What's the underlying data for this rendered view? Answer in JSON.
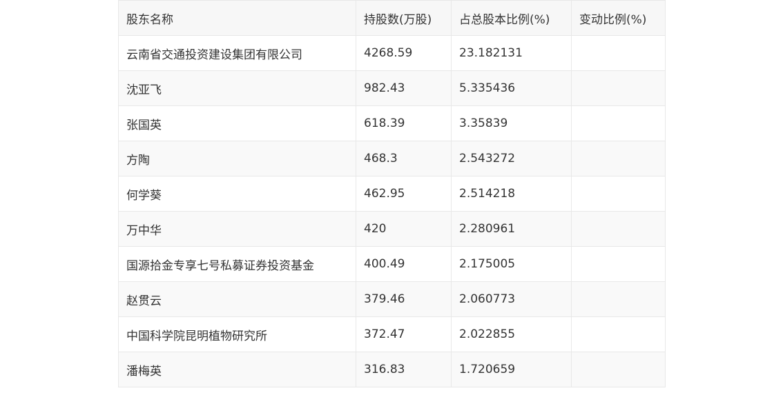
{
  "table": {
    "headers": [
      "股东名称",
      "持股数(万股)",
      "占总股本比例(%)",
      "变动比例(%)"
    ],
    "rows": [
      [
        "云南省交通投资建设集团有限公司",
        "4268.59",
        "23.182131",
        ""
      ],
      [
        "沈亚飞",
        "982.43",
        "5.335436",
        ""
      ],
      [
        "张国英",
        "618.39",
        "3.35839",
        ""
      ],
      [
        "方陶",
        "468.3",
        "2.543272",
        ""
      ],
      [
        "何学葵",
        "462.95",
        "2.514218",
        ""
      ],
      [
        "万中华",
        "420",
        "2.280961",
        ""
      ],
      [
        "国源拾金专享七号私募证券投资基金",
        "400.49",
        "2.175005",
        ""
      ],
      [
        "赵贯云",
        "379.46",
        "2.060773",
        ""
      ],
      [
        "中国科学院昆明植物研究所",
        "372.47",
        "2.022855",
        ""
      ],
      [
        "潘梅英",
        "316.83",
        "1.720659",
        ""
      ]
    ]
  }
}
